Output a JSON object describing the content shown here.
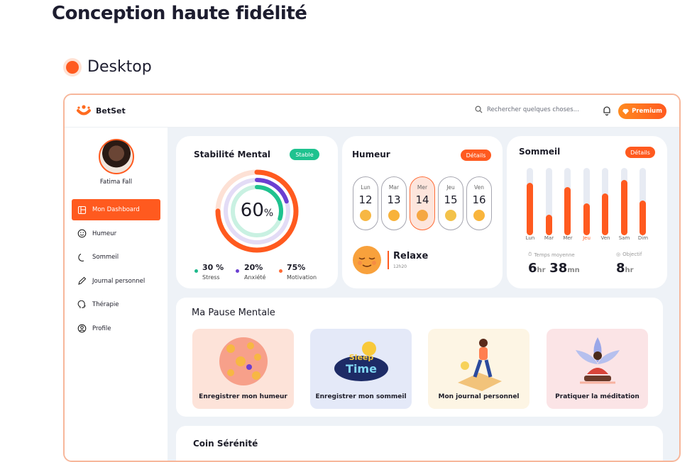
{
  "header": {
    "title": "Conception haute fidélité",
    "section": "Desktop"
  },
  "app": {
    "brand": "BetSet",
    "search_placeholder": "Rechercher quelques choses...",
    "premium_label": "Premium",
    "user_name": "Fatima Fall",
    "nav": [
      {
        "label": "Mon Dashboard",
        "icon": "dashboard-icon",
        "active": true
      },
      {
        "label": "Humeur",
        "icon": "smile-icon",
        "active": false
      },
      {
        "label": "Sommeil",
        "icon": "moon-icon",
        "active": false
      },
      {
        "label": "Journal personnel",
        "icon": "pen-icon",
        "active": false
      },
      {
        "label": "Thérapie",
        "icon": "brain-icon",
        "active": false
      },
      {
        "label": "Profile",
        "icon": "user-icon",
        "active": false
      }
    ]
  },
  "stability": {
    "title": "Stabilité Mental",
    "badge": "Stable",
    "score": "60",
    "score_unit": "%",
    "stats": [
      {
        "value": "30 %",
        "label": "Stress",
        "color": "#1fb98c"
      },
      {
        "value": "20%",
        "label": "Anxiété",
        "color": "#6b3fd1"
      },
      {
        "value": "75%",
        "label": "Motivation",
        "color": "#ff6b35"
      }
    ]
  },
  "mood": {
    "title": "Humeur",
    "details": "Détails",
    "days": [
      {
        "name": "Lun",
        "num": "12"
      },
      {
        "name": "Mar",
        "num": "13"
      },
      {
        "name": "Mer",
        "num": "14"
      },
      {
        "name": "Jeu",
        "num": "15"
      },
      {
        "name": "Ven",
        "num": "16"
      }
    ],
    "current": "Relaxe",
    "time": "12h20"
  },
  "sleep": {
    "title": "Sommeil",
    "details": "Détails",
    "days": [
      "Lun",
      "Mar",
      "Mer",
      "Jeu",
      "Ven",
      "Sam",
      "Dim"
    ],
    "levels": [
      0.78,
      0.3,
      0.72,
      0.47,
      0.62,
      0.82,
      0.52
    ],
    "avg_label": "Temps moyenne",
    "avg_hours": "6",
    "avg_minutes": "38",
    "hr_unit": "hr",
    "mn_unit": "mn",
    "goal_label": "Objectif",
    "goal_hours": "8"
  },
  "pause": {
    "title": "Ma Pause Mentale",
    "tiles": [
      {
        "label": "Enregistrer mon humeur",
        "bg": "#fde3d9"
      },
      {
        "label": "Enregistrer mon sommeil",
        "bg": "#e4e9f8"
      },
      {
        "label": "Mon journal personnel",
        "bg": "#fdf5e4"
      },
      {
        "label": "Pratiquer la méditation",
        "bg": "#fbe4e6"
      }
    ],
    "sleep_art_text": "Sleep Time"
  },
  "serenity": {
    "title": "Coin Sérénité"
  }
}
